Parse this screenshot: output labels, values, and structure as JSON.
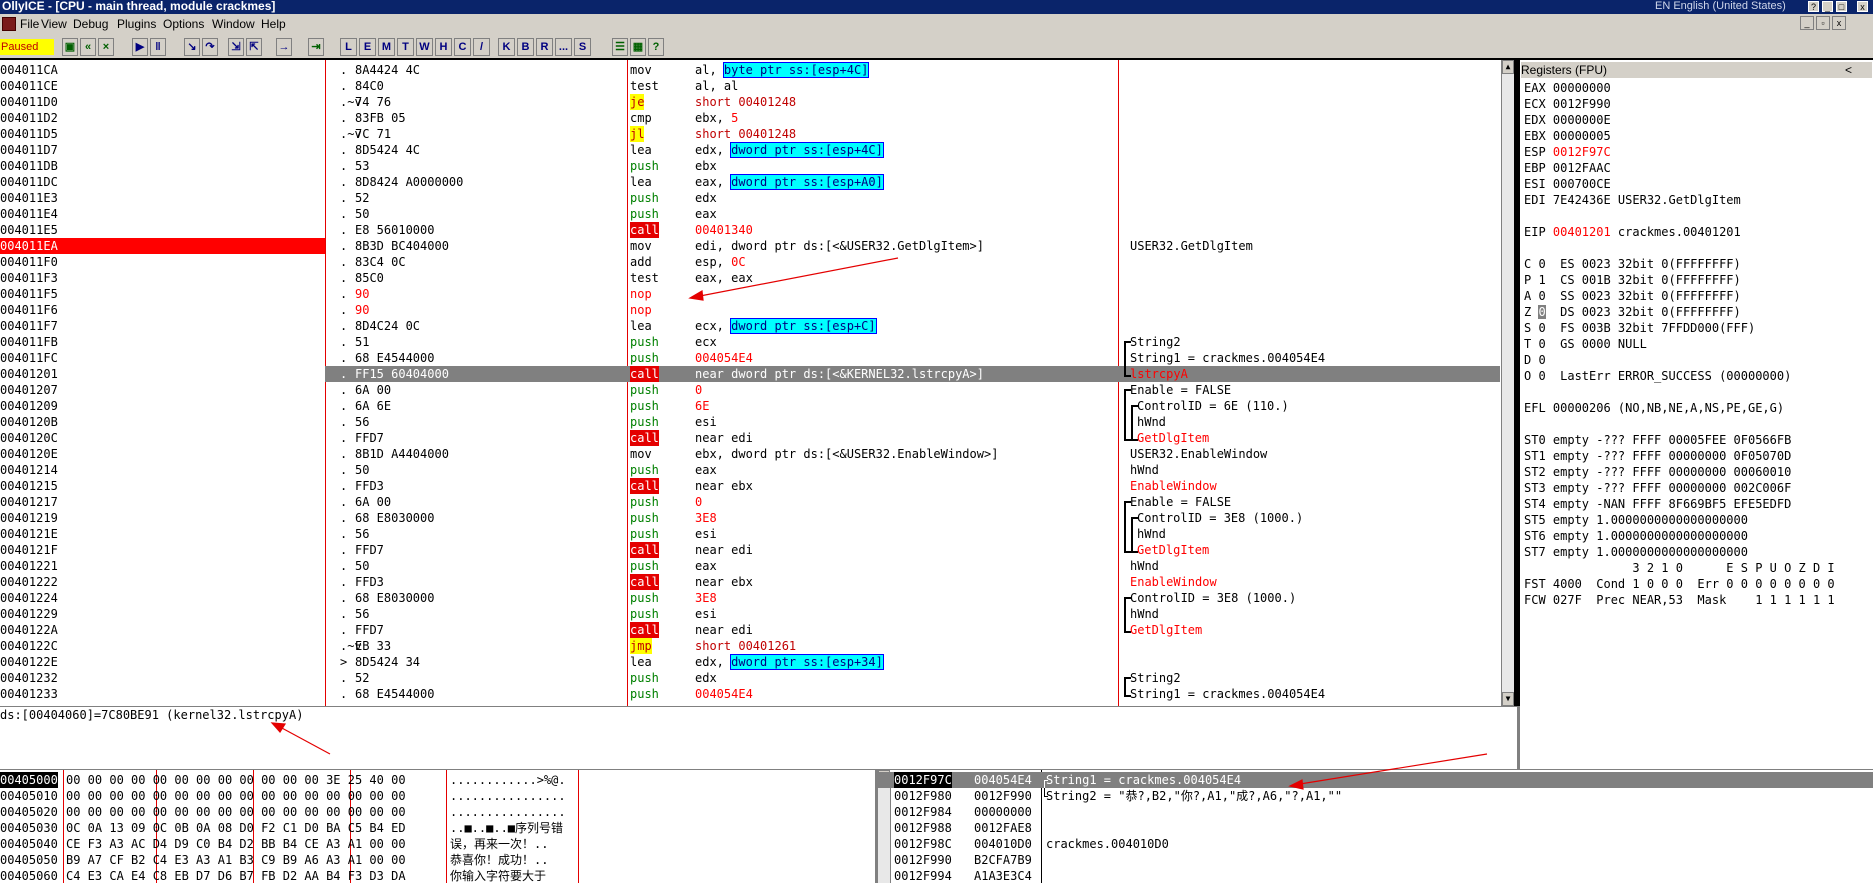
{
  "window": {
    "title": "OllyICE - [CPU - main thread, module crackmes]",
    "language": "EN English (United States)"
  },
  "menu": [
    "File",
    "View",
    "Debug",
    "Plugins",
    "Options",
    "Window",
    "Help"
  ],
  "toolbar": {
    "status": "Paused",
    "letters": [
      "L",
      "E",
      "M",
      "T",
      "W",
      "H",
      "C",
      "/",
      "K",
      "B",
      "R",
      "...",
      "S"
    ]
  },
  "disasm": {
    "rows": [
      {
        "addr": "004011CA",
        "dot": ".",
        "hex": "8A4424 4C",
        "mn": "mov",
        "op": "al, byte ptr ss:[esp+4C]",
        "cm": ""
      },
      {
        "addr": "004011CE",
        "dot": ".",
        "hex": "84C0",
        "mn": "test",
        "op": "al, al",
        "cm": ""
      },
      {
        "addr": "004011D0",
        "dot": ".~v",
        "hex": "74 76",
        "mn": "je",
        "op": "short 00401248",
        "cm": ""
      },
      {
        "addr": "004011D2",
        "dot": ".",
        "hex": "83FB 05",
        "mn": "cmp",
        "op": "ebx, 5",
        "cm": ""
      },
      {
        "addr": "004011D5",
        "dot": ".~v",
        "hex": "7C 71",
        "mn": "jl",
        "op": "short 00401248",
        "cm": ""
      },
      {
        "addr": "004011D7",
        "dot": ".",
        "hex": "8D5424 4C",
        "mn": "lea",
        "op": "edx, dword ptr ss:[esp+4C]",
        "cm": ""
      },
      {
        "addr": "004011DB",
        "dot": ".",
        "hex": "53",
        "mn": "push",
        "op": "ebx",
        "cm": ""
      },
      {
        "addr": "004011DC",
        "dot": ".",
        "hex": "8D8424 A0000000",
        "mn": "lea",
        "op": "eax, dword ptr ss:[esp+A0]",
        "cm": ""
      },
      {
        "addr": "004011E3",
        "dot": ".",
        "hex": "52",
        "mn": "push",
        "op": "edx",
        "cm": ""
      },
      {
        "addr": "004011E4",
        "dot": ".",
        "hex": "50",
        "mn": "push",
        "op": "eax",
        "cm": ""
      },
      {
        "addr": "004011E5",
        "dot": ".",
        "hex": "E8 56010000",
        "mn": "call",
        "op": "00401340",
        "cm": ""
      },
      {
        "addr": "004011EA",
        "dot": ".",
        "hex": "8B3D BC404000",
        "mn": "mov",
        "op": "edi, dword ptr ds:[<&USER32.GetDlgItem>]",
        "cm": "USER32.GetDlgItem"
      },
      {
        "addr": "004011F0",
        "dot": ".",
        "hex": "83C4 0C",
        "mn": "add",
        "op": "esp, 0C",
        "cm": ""
      },
      {
        "addr": "004011F3",
        "dot": ".",
        "hex": "85C0",
        "mn": "test",
        "op": "eax, eax",
        "cm": ""
      },
      {
        "addr": "004011F5",
        "dot": ".",
        "hex": "90",
        "mn": "nop",
        "op": "",
        "cm": ""
      },
      {
        "addr": "004011F6",
        "dot": ".",
        "hex": "90",
        "mn": "nop",
        "op": "",
        "cm": ""
      },
      {
        "addr": "004011F7",
        "dot": ".",
        "hex": "8D4C24 0C",
        "mn": "lea",
        "op": "ecx, dword ptr ss:[esp+C]",
        "cm": ""
      },
      {
        "addr": "004011FB",
        "dot": ".",
        "hex": "51",
        "mn": "push",
        "op": "ecx",
        "cm": "String2"
      },
      {
        "addr": "004011FC",
        "dot": ".",
        "hex": "68 E4544000",
        "mn": "push",
        "op": "004054E4",
        "cm": "String1 = crackmes.004054E4"
      },
      {
        "addr": "00401201",
        "dot": ".",
        "hex": "FF15 60404000",
        "mn": "call",
        "op": "near dword ptr ds:[<&KERNEL32.lstrcpyA>]",
        "cm": "lstrcpyA"
      },
      {
        "addr": "00401207",
        "dot": ".",
        "hex": "6A 00",
        "mn": "push",
        "op": "0",
        "cm": "Enable = FALSE"
      },
      {
        "addr": "00401209",
        "dot": ".",
        "hex": "6A 6E",
        "mn": "push",
        "op": "6E",
        "cm": "ControlID = 6E (110.)"
      },
      {
        "addr": "0040120B",
        "dot": ".",
        "hex": "56",
        "mn": "push",
        "op": "esi",
        "cm": "hWnd"
      },
      {
        "addr": "0040120C",
        "dot": ".",
        "hex": "FFD7",
        "mn": "call",
        "op": "near edi",
        "cm": "GetDlgItem"
      },
      {
        "addr": "0040120E",
        "dot": ".",
        "hex": "8B1D A4404000",
        "mn": "mov",
        "op": "ebx, dword ptr ds:[<&USER32.EnableWindow>]",
        "cm": "USER32.EnableWindow"
      },
      {
        "addr": "00401214",
        "dot": ".",
        "hex": "50",
        "mn": "push",
        "op": "eax",
        "cm": "hWnd"
      },
      {
        "addr": "00401215",
        "dot": ".",
        "hex": "FFD3",
        "mn": "call",
        "op": "near ebx",
        "cm": "EnableWindow"
      },
      {
        "addr": "00401217",
        "dot": ".",
        "hex": "6A 00",
        "mn": "push",
        "op": "0",
        "cm": "Enable = FALSE"
      },
      {
        "addr": "00401219",
        "dot": ".",
        "hex": "68 E8030000",
        "mn": "push",
        "op": "3E8",
        "cm": "ControlID = 3E8 (1000.)"
      },
      {
        "addr": "0040121E",
        "dot": ".",
        "hex": "56",
        "mn": "push",
        "op": "esi",
        "cm": "hWnd"
      },
      {
        "addr": "0040121F",
        "dot": ".",
        "hex": "FFD7",
        "mn": "call",
        "op": "near edi",
        "cm": "GetDlgItem"
      },
      {
        "addr": "00401221",
        "dot": ".",
        "hex": "50",
        "mn": "push",
        "op": "eax",
        "cm": "hWnd"
      },
      {
        "addr": "00401222",
        "dot": ".",
        "hex": "FFD3",
        "mn": "call",
        "op": "near ebx",
        "cm": "EnableWindow"
      },
      {
        "addr": "00401224",
        "dot": ".",
        "hex": "68 E8030000",
        "mn": "push",
        "op": "3E8",
        "cm": "ControlID = 3E8 (1000.)"
      },
      {
        "addr": "00401229",
        "dot": ".",
        "hex": "56",
        "mn": "push",
        "op": "esi",
        "cm": "hWnd"
      },
      {
        "addr": "0040122A",
        "dot": ".",
        "hex": "FFD7",
        "mn": "call",
        "op": "near edi",
        "cm": "GetDlgItem"
      },
      {
        "addr": "0040122C",
        "dot": ".~v",
        "hex": "EB 33",
        "mn": "jmp",
        "op": "short 00401261",
        "cm": ""
      },
      {
        "addr": "0040122E",
        "dot": ">",
        "hex": "8D5424 34",
        "mn": "lea",
        "op": "edx, dword ptr ss:[esp+34]",
        "cm": ""
      },
      {
        "addr": "00401232",
        "dot": ".",
        "hex": "52",
        "mn": "push",
        "op": "edx",
        "cm": "String2"
      },
      {
        "addr": "00401233",
        "dot": ".",
        "hex": "68 E4544000",
        "mn": "push",
        "op": "004054E4",
        "cm": "String1 = crackmes.004054E4"
      }
    ]
  },
  "info_line": "ds:[00404060]=7C80BE91 (kernel32.lstrcpyA)",
  "registers": {
    "title": "Registers (FPU)",
    "lines": [
      "EAX 00000000",
      "ECX 0012F990",
      "EDX 0000000E",
      "EBX 00000005",
      "ESP 0012F97C",
      "EBP 0012FAAC",
      "ESI 000700CE",
      "EDI 7E42436E USER32.GetDlgItem",
      "",
      "EIP 00401201 crackmes.00401201",
      "",
      "C 0  ES 0023 32bit 0(FFFFFFFF)",
      "P 1  CS 001B 32bit 0(FFFFFFFF)",
      "A 0  SS 0023 32bit 0(FFFFFFFF)",
      "Z 0  DS 0023 32bit 0(FFFFFFFF)",
      "S 0  FS 003B 32bit 7FFDD000(FFF)",
      "T 0  GS 0000 NULL",
      "D 0",
      "O 0  LastErr ERROR_SUCCESS (00000000)",
      "",
      "EFL 00000206 (NO,NB,NE,A,NS,PE,GE,G)",
      "",
      "ST0 empty -??? FFFF 00005FEE 0F0566FB",
      "ST1 empty -??? FFFF 00000000 0F05070D",
      "ST2 empty -??? FFFF 00000000 00060010",
      "ST3 empty -??? FFFF 00000000 002C006F",
      "ST4 empty -NAN FFFF 8F669BF5 EFE5EDFD",
      "ST5 empty 1.0000000000000000000",
      "ST6 empty 1.0000000000000000000",
      "ST7 empty 1.0000000000000000000",
      "               3 2 1 0      E S P U O Z D I",
      "FST 4000  Cond 1 0 0 0  Err 0 0 0 0 0 0 0 0",
      "FCW 027F  Prec NEAR,53  Mask    1 1 1 1 1 1"
    ]
  },
  "dump": {
    "rows": [
      {
        "addr": "00405000",
        "hex": "00 00 00 00 00 00 00 00 00 00 00 00 3E 25 40 00",
        "text": "............>%@."
      },
      {
        "addr": "00405010",
        "hex": "00 00 00 00 00 00 00 00 00 00 00 00 00 00 00 00",
        "text": "................"
      },
      {
        "addr": "00405020",
        "hex": "00 00 00 00 00 00 00 00 00 00 00 00 00 00 00 00",
        "text": "................"
      },
      {
        "addr": "00405030",
        "hex": "0C 0A 13 09 0C 0B 0A 08 D0 F2 C1 D0 BA C5 B4 ED",
        "text": "..■..■..■序列号错"
      },
      {
        "addr": "00405040",
        "hex": "CE F3 A3 AC D4 D9 C0 B4 D2 BB B4 CE A3 A1 00 00",
        "text": "误，再来一次！.."
      },
      {
        "addr": "00405050",
        "hex": "B9 A7 CF B2 C4 E3 A3 A1 B3 C9 B9 A6 A3 A1 00 00",
        "text": "恭喜你！成功！.."
      },
      {
        "addr": "00405060",
        "hex": "C4 E3 CA E4 C8 EB D7 D6 B7 FB D2 AA B4 F3 D3 DA",
        "text": "你输入字符要大于"
      }
    ]
  },
  "stack": {
    "rows": [
      {
        "addr": "0012F97C",
        "val": "004054E4",
        "cm": "String1 = crackmes.004054E4"
      },
      {
        "addr": "0012F980",
        "val": "0012F990",
        "cm": "String2 = \"恭?,B2,\"你?,A1,\"成?,A6,\"?,A1,\"\""
      },
      {
        "addr": "0012F984",
        "val": "00000000",
        "cm": ""
      },
      {
        "addr": "0012F988",
        "val": "0012FAE8",
        "cm": ""
      },
      {
        "addr": "0012F98C",
        "val": "004010D0",
        "cm": "crackmes.004010D0"
      },
      {
        "addr": "0012F990",
        "val": "B2CFA7B9",
        "cm": ""
      },
      {
        "addr": "0012F994",
        "val": "A1A3E3C4",
        "cm": ""
      }
    ]
  }
}
